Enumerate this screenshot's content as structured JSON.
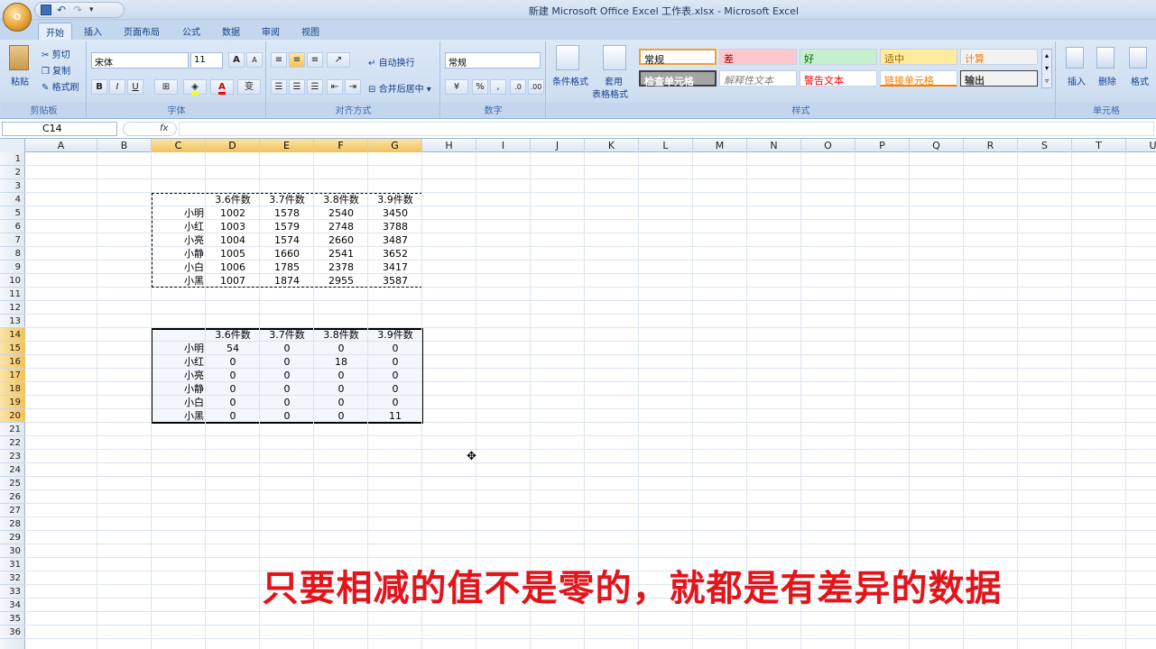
{
  "title": "新建 Microsoft Office Excel 工作表.xlsx - Microsoft Excel",
  "office_button": "O",
  "tabs": [
    "开始",
    "插入",
    "页面布局",
    "公式",
    "数据",
    "审阅",
    "视图"
  ],
  "ribbon": {
    "clipboard": {
      "paste": "粘贴",
      "cut": "剪切",
      "copy": "复制",
      "format_painter": "格式刷",
      "label": "剪贴板"
    },
    "font": {
      "name": "宋体",
      "size": "11",
      "bold": "B",
      "italic": "I",
      "underline": "U",
      "label": "字体",
      "grow": "A",
      "shrink": "A",
      "font_color": "A",
      "phonetic": "变"
    },
    "alignment": {
      "wrap": "自动换行",
      "merge": "合并后居中",
      "label": "对齐方式"
    },
    "number": {
      "format": "常规",
      "percent": "%",
      "comma": ",",
      "inc": ".0",
      "dec": ".00",
      "label": "数字"
    },
    "styles": {
      "conditional": "条件格式",
      "table_format": "套用",
      "table_format2": "表格格式",
      "label": "样式",
      "cells": [
        {
          "text": "常规",
          "bg": "#ffffff",
          "color": "#000000"
        },
        {
          "text": "差",
          "bg": "#ffc7ce",
          "color": "#9c0006"
        },
        {
          "text": "好",
          "bg": "#c6efce",
          "color": "#006100"
        },
        {
          "text": "适中",
          "bg": "#ffeb9c",
          "color": "#9c6500"
        },
        {
          "text": "计算",
          "bg": "#f2f2f2",
          "color": "#fa7d00"
        },
        {
          "text": "检查单元格",
          "bg": "#a5a5a5",
          "color": "#ffffff"
        },
        {
          "text": "解释性文本",
          "bg": "#ffffff",
          "color": "#7f7f7f"
        },
        {
          "text": "警告文本",
          "bg": "#ffffff",
          "color": "#ff0000"
        },
        {
          "text": "链接单元格",
          "bg": "#ffffff",
          "color": "#fa7d00"
        },
        {
          "text": "输出",
          "bg": "#f2f2f2",
          "color": "#3f3f3f"
        }
      ]
    },
    "cells": {
      "insert": "插入",
      "delete": "删除",
      "format": "格式",
      "label": "单元格"
    }
  },
  "name_box": "C14",
  "fx": "fx",
  "columns": [
    "A",
    "B",
    "C",
    "D",
    "E",
    "F",
    "G",
    "H",
    "I",
    "J",
    "K",
    "L",
    "M",
    "N",
    "O",
    "P",
    "Q",
    "R",
    "S",
    "T",
    "U"
  ],
  "rows": [
    "1",
    "2",
    "3",
    "4",
    "5",
    "6",
    "7",
    "8",
    "9",
    "10",
    "11",
    "12",
    "13",
    "14",
    "15",
    "16",
    "17",
    "18",
    "19",
    "20",
    "21",
    "22",
    "23",
    "24",
    "25",
    "26",
    "27",
    "28",
    "29",
    "30",
    "31",
    "32",
    "33",
    "34",
    "35",
    "36"
  ],
  "table1": {
    "headers": [
      "3.6件数",
      "3.7件数",
      "3.8件数",
      "3.9件数"
    ],
    "rows": [
      [
        "小明",
        "1002",
        "1578",
        "2540",
        "3450"
      ],
      [
        "小红",
        "1003",
        "1579",
        "2748",
        "3788"
      ],
      [
        "小亮",
        "1004",
        "1574",
        "2660",
        "3487"
      ],
      [
        "小静",
        "1005",
        "1660",
        "2541",
        "3652"
      ],
      [
        "小白",
        "1006",
        "1785",
        "2378",
        "3417"
      ],
      [
        "小黑",
        "1007",
        "1874",
        "2955",
        "3587"
      ]
    ]
  },
  "table2": {
    "headers": [
      "3.6件数",
      "3.7件数",
      "3.8件数",
      "3.9件数"
    ],
    "rows": [
      [
        "小明",
        "54",
        "0",
        "0",
        "0"
      ],
      [
        "小红",
        "0",
        "0",
        "18",
        "0"
      ],
      [
        "小亮",
        "0",
        "0",
        "0",
        "0"
      ],
      [
        "小静",
        "0",
        "0",
        "0",
        "0"
      ],
      [
        "小白",
        "0",
        "0",
        "0",
        "0"
      ],
      [
        "小黑",
        "0",
        "0",
        "0",
        "11"
      ]
    ]
  },
  "subtitle": "只要相减的值不是零的，就都是有差异的数据"
}
